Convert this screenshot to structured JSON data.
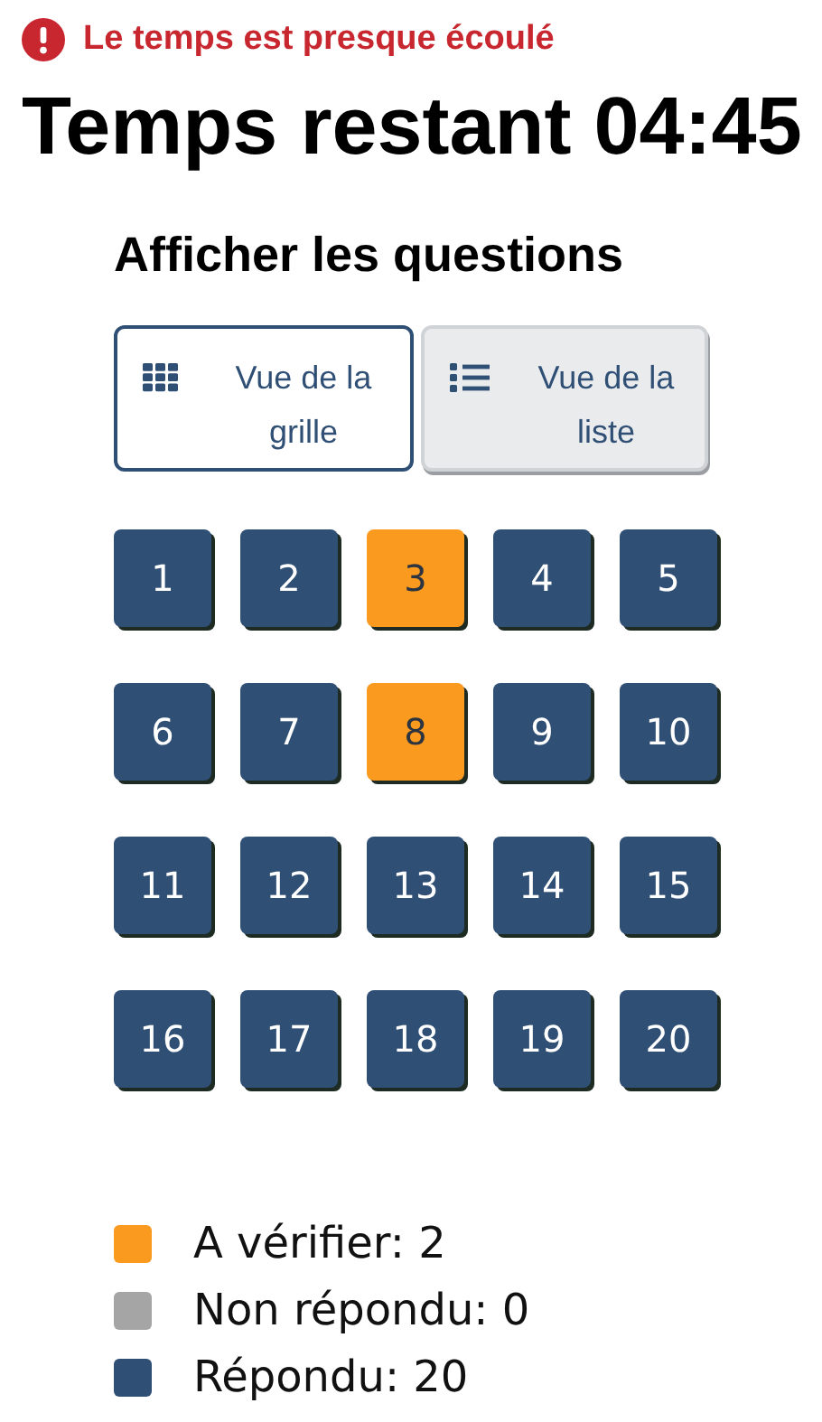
{
  "warning": "Le temps est presque écoulé",
  "timer": "Temps restant 04:45",
  "heading": "Afficher les questions",
  "views": [
    {
      "kind": "grid",
      "label": "Vue de la grille",
      "selected": true
    },
    {
      "kind": "list",
      "label": "Vue de la liste",
      "selected": false
    }
  ],
  "questions": [
    {
      "label": "1",
      "flagged": false
    },
    {
      "label": "2",
      "flagged": false
    },
    {
      "label": "3",
      "flagged": true
    },
    {
      "label": "4",
      "flagged": false
    },
    {
      "label": "5",
      "flagged": false
    },
    {
      "label": "6",
      "flagged": false
    },
    {
      "label": "7",
      "flagged": false
    },
    {
      "label": "8",
      "flagged": true
    },
    {
      "label": "9",
      "flagged": false
    },
    {
      "label": "10",
      "flagged": false
    },
    {
      "label": "11",
      "flagged": false
    },
    {
      "label": "12",
      "flagged": false
    },
    {
      "label": "13",
      "flagged": false
    },
    {
      "label": "14",
      "flagged": false
    },
    {
      "label": "15",
      "flagged": false
    },
    {
      "label": "16",
      "flagged": false
    },
    {
      "label": "17",
      "flagged": false
    },
    {
      "label": "18",
      "flagged": false
    },
    {
      "label": "19",
      "flagged": false
    },
    {
      "label": "20",
      "flagged": false
    }
  ],
  "legend": [
    {
      "label": "A vérifier: 2",
      "color": "#fa9a1e"
    },
    {
      "label": "Non répondu: 0",
      "color": "#a5a5a5"
    },
    {
      "label": "Répondu: 20",
      "color": "#304f75"
    }
  ]
}
